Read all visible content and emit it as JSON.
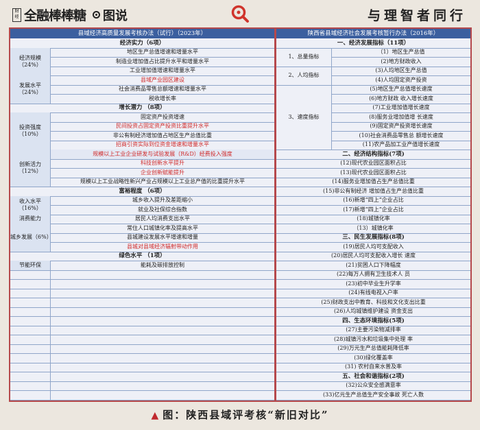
{
  "header": {
    "logo_small": "财经",
    "brand_name": "全融棒棒糖",
    "brand_sub": "图说",
    "slogan": "与理智者同行"
  },
  "left_table": {
    "title": "县域经济高质量发展考核办法（试行）（2023年）",
    "sections": [
      {
        "heading": "经济实力（6项）"
      },
      {
        "heading": "增长潜力 （8项）"
      },
      {
        "heading": "富裕程度 （6项）"
      },
      {
        "heading": "绿色水平 （1项）"
      }
    ],
    "groups": [
      {
        "label": "经济规模（24%）",
        "items": [
          "地区生产总值增速和增量水平",
          "制造业增加值占比提升水平和增量水平",
          "工业增加值增速和增量水平"
        ]
      },
      {
        "label": "发展水平（24%）",
        "items": [
          "县域产业园区建设",
          "社会消费品零售总额增速和增量水平",
          "税收增长率"
        ]
      },
      {
        "label": "投资强度（10%）",
        "items": [
          "固定资产投资增速",
          "民间投资占固定资产投资比重提升水平",
          "非公有制经济增加值占地区生产总值比重",
          "招商引资实际到位资金增速和增量水平"
        ]
      },
      {
        "label": "创新活力（12%）",
        "items": [
          "规模以上工业企业研发与试验发展（R&D）经费投入强度",
          "科技创新水平提升",
          "企业创新赋能提升",
          "规模以上工业战略性新兴产业占规模以上工业总产值的比重提升水平"
        ]
      },
      {
        "label": "收入水平（16%）",
        "items": [
          "城乡收入提升及差距缩小",
          "就业及社保综合指数"
        ]
      },
      {
        "label": "消费能力",
        "items": [
          "居民人均消费支出水平"
        ]
      },
      {
        "label": "城乡发展（6%）",
        "items": [
          "常住人口城镇化率及提高水平",
          "县城建设发展水平增速和增量",
          "县城对县域经济辐射带动作用"
        ]
      },
      {
        "label": "节能环保",
        "items": [
          "能耗及碳排放控制"
        ]
      }
    ]
  },
  "right_table": {
    "title": "陕西省县域经济社会发展考核暂行办法（2016年）",
    "sections": [
      "一、经济发展指标（11项）",
      "二、经济结构指标(7项)",
      "三、民生发展指标(8项)",
      "四、生态环境指标(5项)",
      "五、社会和谐指标(2项)"
    ],
    "groups": [
      {
        "label": "1、总量指标",
        "items": [
          "（1）地区生产总值",
          "(2)地方财政收入"
        ]
      },
      {
        "label": "2、人均指标",
        "items": [
          "(3)人均地区生产总值",
          "(4)人均固定资产投资"
        ]
      },
      {
        "label": "3、速度指标",
        "items": [
          "(5)地区生产总值增长速度",
          "(6)地方财政 收入增长速度",
          "(7)工业增加值增长速度",
          "(8)服务业增加值增 长速度",
          "(9)固定资产投资增长速度",
          "(10)社会消费品零售总 额增长速度",
          "(11)农产品加工业产值增长速度"
        ]
      }
    ],
    "structure_items": [
      "(12)现代农业园区面积占比",
      "(13)现代农业园区面积占比",
      "(14)服务业增加值占生产总值比重",
      "(15)非公有制经济 增加值占生产总值比重",
      "(16)新增“四上”企业占比",
      "(17)新增“四上”企业占比",
      "(18)城镇化率"
    ],
    "livelihood_items": [
      "（13）城镇化率",
      "(19)居民人均可支配收入",
      "(20)居民人均可支配收入增长 速度",
      "(21)贫困人口下降幅度",
      "(22)每万人拥有卫生技术人 员",
      "(23)初中毕业生升学率",
      "(24)有线电视入户率",
      "(25)财政支出中教育、科技和文化支出比重",
      "(26)人均城镇维护建设 资金支出"
    ],
    "eco_items": [
      "(27)主要污染物减排率",
      "(28)城镇污水和垃圾集中处理 率",
      "(29)万元生产总值能耗降低率",
      "(30)绿化覆盖率",
      "(31) 农村自来水普及率"
    ],
    "social_items": [
      "(32)公众安全感满意率",
      "(33)亿元生产总值生产安全事故 死亡人数"
    ]
  },
  "caption": {
    "text": "图：陕西县域评考核“新旧对比”"
  }
}
